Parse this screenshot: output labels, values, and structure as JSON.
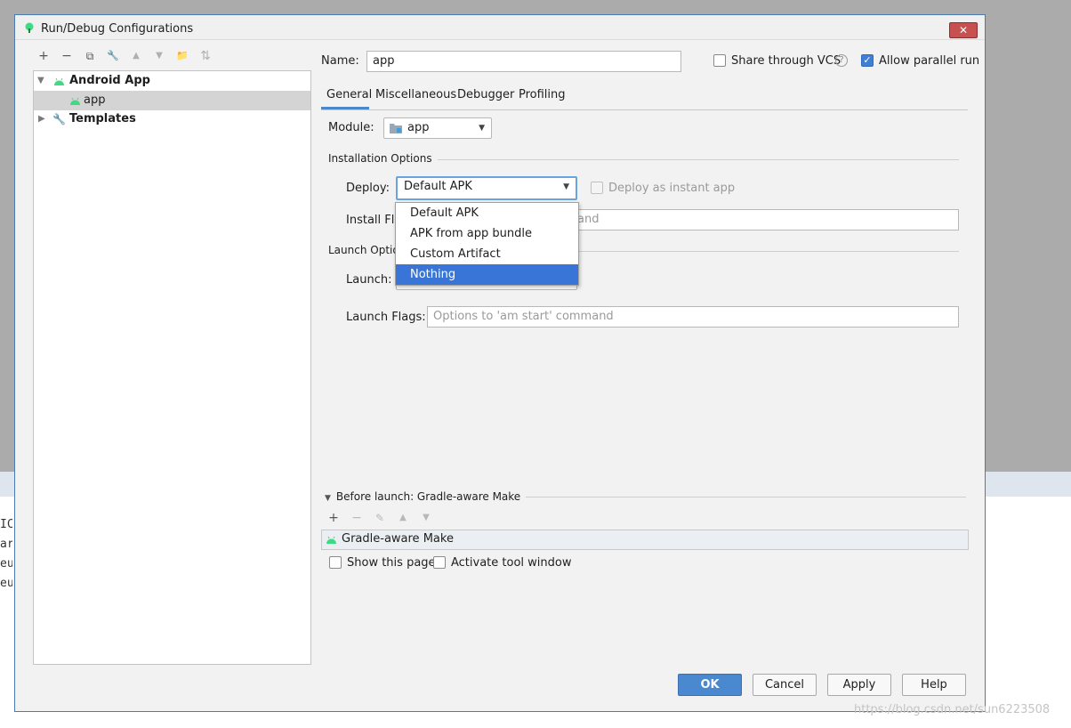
{
  "dialog": {
    "title": "Run/Debug Configurations",
    "close": "✕"
  },
  "tree": {
    "toolbar": [
      {
        "name": "add",
        "glyph": "+"
      },
      {
        "name": "remove",
        "glyph": "−"
      },
      {
        "name": "copy",
        "glyph": "⧉"
      },
      {
        "name": "edit-defaults",
        "glyph": "🔧"
      },
      {
        "name": "move-up",
        "glyph": "▲"
      },
      {
        "name": "move-down",
        "glyph": "▼"
      },
      {
        "name": "folder",
        "glyph": "📁"
      },
      {
        "name": "sort",
        "glyph": "⇅"
      }
    ],
    "android_app": "Android App",
    "app": "app",
    "templates": "Templates"
  },
  "form": {
    "name_label": "Name:",
    "name_value": "app",
    "share_vcs": "Share through VCS",
    "share_vcs_checked": false,
    "allow_parallel": "Allow parallel run",
    "allow_parallel_checked": true,
    "help": "?"
  },
  "tabs": [
    {
      "label": "General",
      "active": true
    },
    {
      "label": "Miscellaneous",
      "active": false
    },
    {
      "label": "Debugger",
      "active": false
    },
    {
      "label": "Profiling",
      "active": false
    }
  ],
  "general": {
    "module_label": "Module:",
    "module_value": "app",
    "installation_options": "Installation Options",
    "deploy_label": "Deploy:",
    "deploy_value": "Default APK",
    "deploy_instant": "Deploy as instant app",
    "install_flags_label": "Install Fla",
    "install_flags_placeholder_tail": "and",
    "launch_options": "Launch Optior",
    "launch_label": "Launch:",
    "launch_flags_label": "Launch Flags:",
    "launch_flags_placeholder": "Options to 'am start' command"
  },
  "deploy_dropdown": {
    "options": [
      "Default APK",
      "APK from app bundle",
      "Custom Artifact",
      "Nothing"
    ],
    "selected_index": 3
  },
  "before_launch": {
    "title": "Before launch: Gradle-aware Make",
    "item": "Gradle-aware Make",
    "show_page": "Show this page",
    "activate_tool_window": "Activate tool window"
  },
  "buttons": {
    "ok": "OK",
    "cancel": "Cancel",
    "apply": "Apply",
    "help": "Help"
  },
  "background_code": [
    "IC",
    "arl",
    "eu:",
    "eu:"
  ],
  "watermark": "https://blog.csdn.net/sun6223508",
  "colors": {
    "accent": "#3875d7",
    "android_green": "#3ddc84",
    "close_red": "#c75050"
  }
}
